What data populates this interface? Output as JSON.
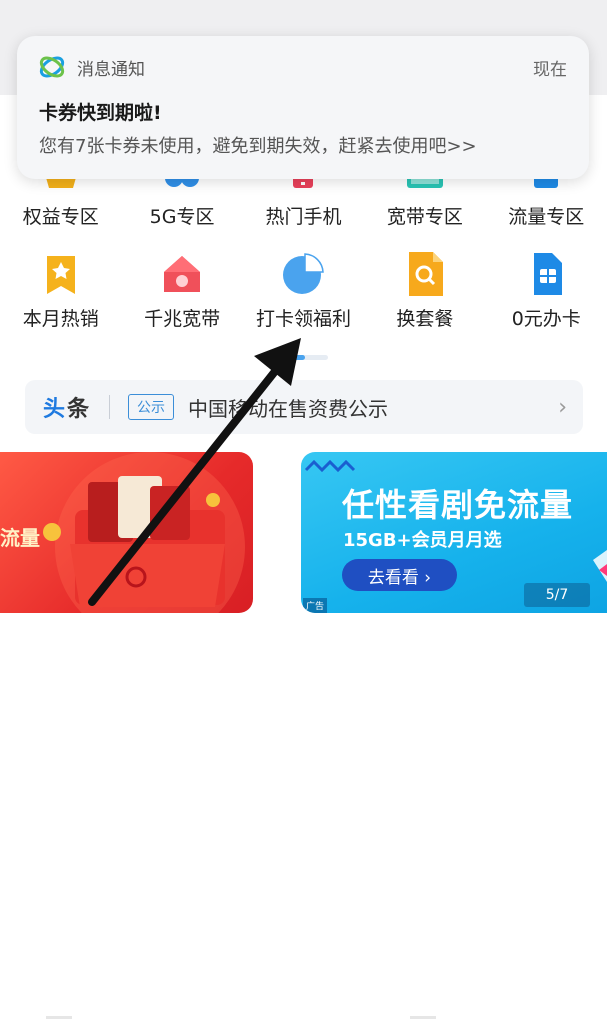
{
  "notification": {
    "app_name": "消息通知",
    "time": "现在",
    "title": "卡券快到期啦!",
    "body": "您有7张卡券未使用，避免到期失效，赶紧去使用吧>>"
  },
  "grid": {
    "row1": [
      {
        "label": "权益专区",
        "icon": "crown-icon"
      },
      {
        "label": "5G专区",
        "icon": "5g-icon"
      },
      {
        "label": "热门手机",
        "icon": "phone-icon"
      },
      {
        "label": "宽带专区",
        "icon": "broadband-icon"
      },
      {
        "label": "流量专区",
        "icon": "data-icon"
      }
    ],
    "row2": [
      {
        "label": "本月热销",
        "icon": "star-bookmark-icon"
      },
      {
        "label": "千兆宽带",
        "icon": "house-icon"
      },
      {
        "label": "打卡领福利",
        "icon": "pie-chart-icon"
      },
      {
        "label": "换套餐",
        "icon": "search-document-icon"
      },
      {
        "label": "0元办卡",
        "icon": "sim-card-icon"
      }
    ]
  },
  "headline": {
    "tag_part1": "头",
    "tag_part2": "条",
    "badge": "公示",
    "text": "中国移动在售资费公示"
  },
  "banner_left": {
    "text": "流量"
  },
  "banner_right": {
    "title": "任性看剧免流量",
    "subtitle": "15GB+会员月月选",
    "button": "去看看 ›",
    "ad_label": "广告",
    "page": "5/7"
  },
  "colors": {
    "accent_blue": "#1f7ae0",
    "banner_red": "#e62a2a",
    "banner_blue": "#16b2ec"
  }
}
